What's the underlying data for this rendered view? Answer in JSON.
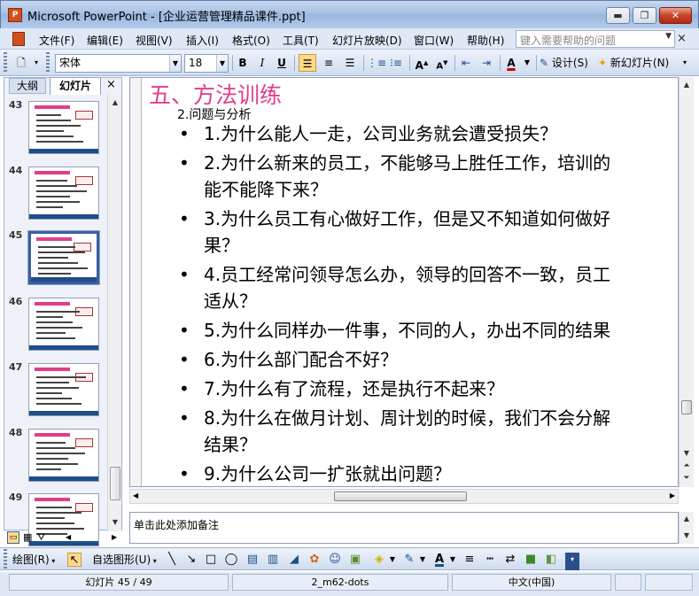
{
  "window": {
    "title": "Microsoft PowerPoint - [企业运营管理精品课件.ppt]",
    "min_label": "▬",
    "max_label": "❐",
    "close_label": "✕"
  },
  "menu": {
    "items": [
      "文件(F)",
      "编辑(E)",
      "视图(V)",
      "插入(I)",
      "格式(O)",
      "工具(T)",
      "幻灯片放映(D)",
      "窗口(W)",
      "帮助(H)"
    ],
    "help_placeholder": "键入需要帮助的问题",
    "close": "×"
  },
  "toolbar": {
    "font_name": "宋体",
    "font_size": "18",
    "bold": "B",
    "italic": "I",
    "underline": "U",
    "design_label": "设计(S)",
    "new_slide_label": "新幻灯片(N)"
  },
  "side_panel": {
    "tab_outline": "大纲",
    "tab_slides": "幻灯片",
    "close": "×",
    "thumbnails": [
      {
        "number": "43",
        "selected": false
      },
      {
        "number": "44",
        "selected": false
      },
      {
        "number": "45",
        "selected": true
      },
      {
        "number": "46",
        "selected": false
      },
      {
        "number": "47",
        "selected": false
      },
      {
        "number": "48",
        "selected": false
      },
      {
        "number": "49",
        "selected": false
      }
    ]
  },
  "slide": {
    "title": "五、方法训练",
    "subtitle": "2.问题与分析",
    "items": [
      "1.为什么能人一走，公司业务就会遭受损失？",
      "2.为什么新来的员工，不能够马上胜任工作，培训的\n能不能降下来？",
      "3.为什么员工有心做好工作，但是又不知道如何做好\n果？",
      "4.员工经常问领导怎么办，领导的回答不一致，员工\n适从？",
      "5.为什么同样办一件事，不同的人，办出不同的结果",
      "6.为什么部门配合不好？",
      "7.为什么有了流程，还是执行不起来？",
      "8.为什么在做月计划、周计划的时候，我们不会分解\n结果？",
      "9.为什么公司一扩张就出问题？"
    ]
  },
  "notes": {
    "placeholder": "单击此处添加备注"
  },
  "drawing_toolbar": {
    "draw_label": "绘图(R)",
    "autoshapes_label": "自选图形(U)"
  },
  "status": {
    "slide_position": "幻灯片 45 / 49",
    "design_name": "2_m62-dots",
    "language": "中文(中国)"
  },
  "colors": {
    "title_pink": "#e23d8a",
    "selection_blue": "#3b5f9b",
    "chrome_blue": "#dfe9f6"
  }
}
